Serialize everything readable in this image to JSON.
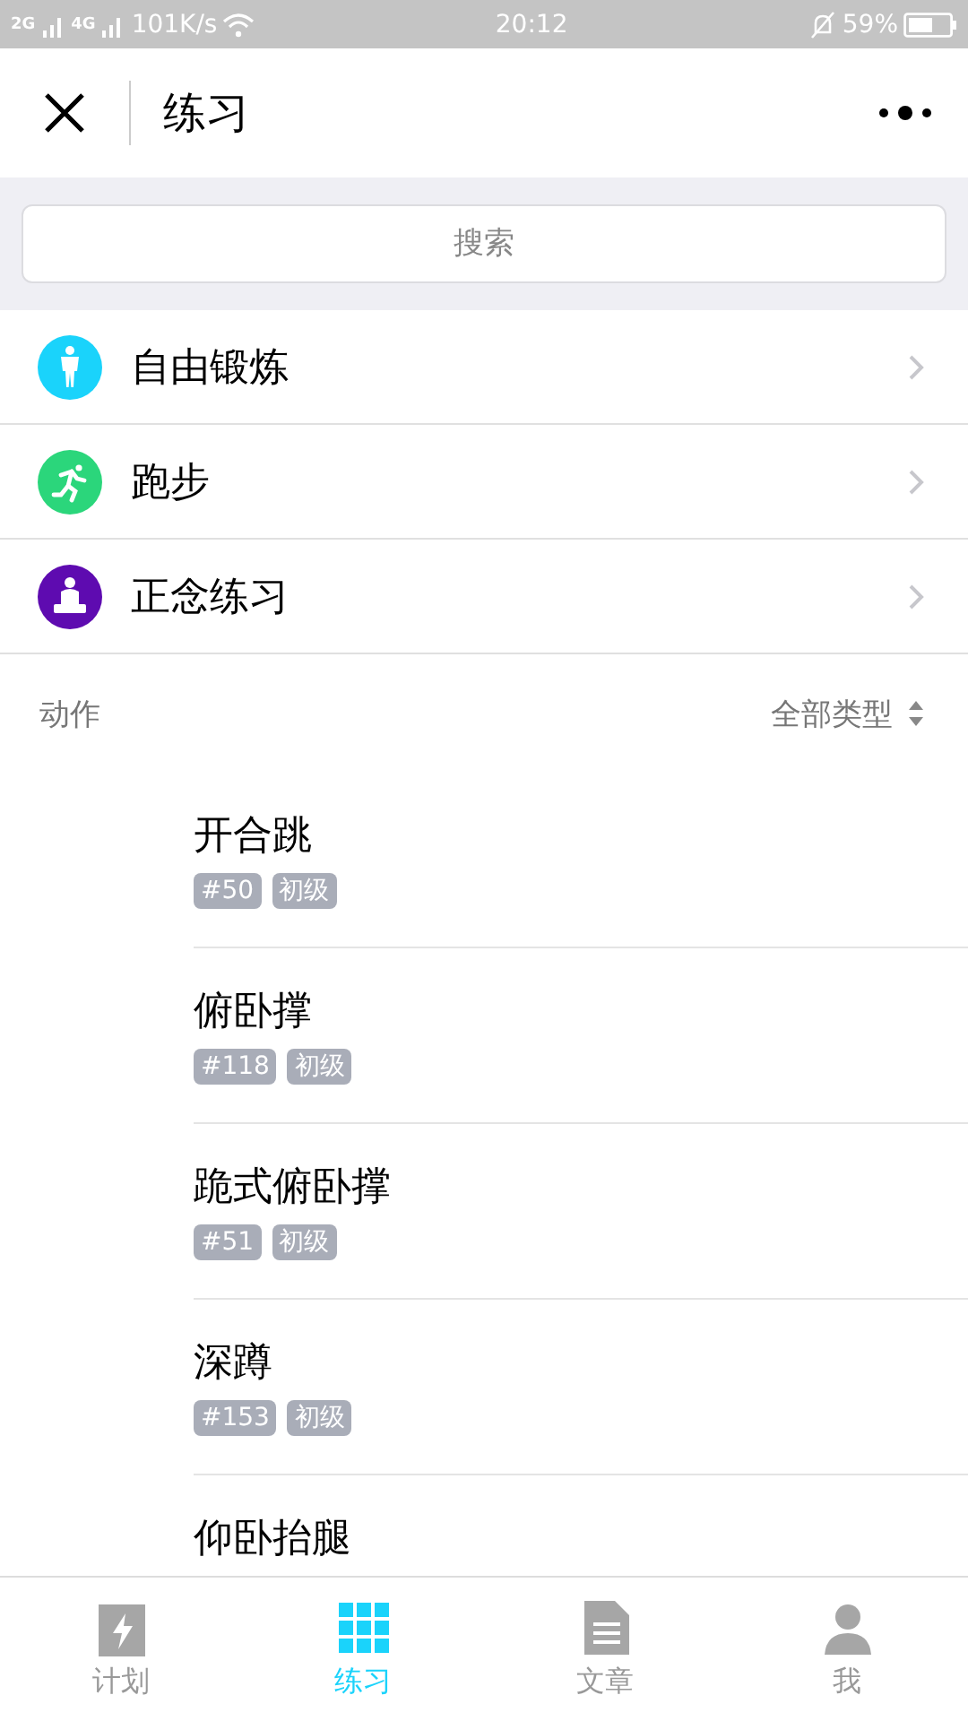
{
  "status_bar": {
    "network_1": "2G",
    "network_2": "4G",
    "speed": "101K/s",
    "time": "20:12",
    "battery": "59%"
  },
  "header": {
    "title": "练习"
  },
  "search": {
    "placeholder": "搜索"
  },
  "categories": [
    {
      "label": "自由锻炼",
      "kind": "body",
      "color": "#1ad3fb"
    },
    {
      "label": "跑步",
      "kind": "run",
      "color": "#2bd67b"
    },
    {
      "label": "正念练习",
      "kind": "meditate",
      "color": "#5e0bb0"
    }
  ],
  "section": {
    "title": "动作",
    "filter": "全部类型"
  },
  "exercises": [
    {
      "name": "开合跳",
      "tags": [
        "#50",
        "初级"
      ]
    },
    {
      "name": "俯卧撑",
      "tags": [
        "#118",
        "初级"
      ]
    },
    {
      "name": "跪式俯卧撑",
      "tags": [
        "#51",
        "初级"
      ]
    },
    {
      "name": "深蹲",
      "tags": [
        "#153",
        "初级"
      ]
    },
    {
      "name": "仰卧抬腿"
    }
  ],
  "tabs": [
    {
      "label": "计划",
      "kind": "plan",
      "selected": false
    },
    {
      "label": "练习",
      "kind": "grid",
      "selected": true
    },
    {
      "label": "文章",
      "kind": "doc",
      "selected": false
    },
    {
      "label": "我",
      "kind": "person",
      "selected": false
    }
  ]
}
